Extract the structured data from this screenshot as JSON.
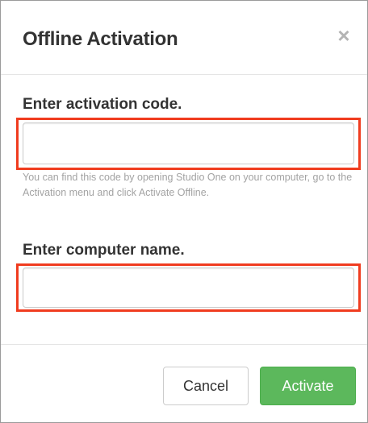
{
  "dialog": {
    "title": "Offline Activation",
    "close_symbol": "×",
    "close_icon": "close-icon"
  },
  "activation_code": {
    "label": "Enter activation code.",
    "value": "",
    "placeholder": "",
    "help_text": "You can find this code by opening Studio One on your computer, go to the Activation menu and click Activate Offline."
  },
  "computer_name": {
    "label": "Enter computer name.",
    "value": "",
    "placeholder": ""
  },
  "footer": {
    "cancel_label": "Cancel",
    "activate_label": "Activate"
  },
  "colors": {
    "highlight": "#f03c1f",
    "primary_button": "#5cb85c",
    "title_text": "#333333",
    "help_text": "#a3a3a3"
  }
}
